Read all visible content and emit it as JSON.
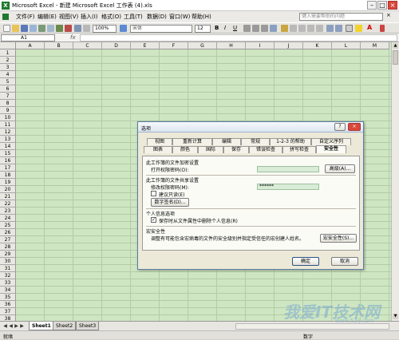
{
  "window": {
    "title": "Microsoft Excel - 新建 Microsoft Excel 工作表 (4).xls",
    "minimize": "–",
    "restore": "□",
    "close": "×"
  },
  "menu": {
    "items": [
      "文件(F)",
      "编辑(E)",
      "视图(V)",
      "插入(I)",
      "格式(O)",
      "工具(T)",
      "数据(D)",
      "窗口(W)",
      "帮助(H)"
    ],
    "help_box_placeholder": "键入需要帮助的问题"
  },
  "toolbar": {
    "zoom": "100%",
    "font": "宋体",
    "font_size": "12",
    "bold": "B",
    "italic": "I",
    "underline": "U",
    "font_color_label": "A"
  },
  "formula_bar": {
    "name_box": "A1",
    "fx": "fx"
  },
  "grid": {
    "columns": [
      "A",
      "B",
      "C",
      "D",
      "E",
      "F",
      "G",
      "H",
      "I",
      "J",
      "K",
      "L",
      "M"
    ],
    "rows": [
      "1",
      "2",
      "3",
      "4",
      "5",
      "6",
      "7",
      "8",
      "9",
      "10",
      "11",
      "12",
      "13",
      "14",
      "15",
      "16",
      "17",
      "18",
      "19",
      "20",
      "21",
      "22",
      "23",
      "24",
      "25",
      "26",
      "27",
      "28",
      "29",
      "30",
      "31",
      "32",
      "33",
      "34",
      "35",
      "36",
      "37",
      "38"
    ]
  },
  "sheets": {
    "tabs": [
      "Sheet1",
      "Sheet2",
      "Sheet3"
    ],
    "active": "Sheet1"
  },
  "status": {
    "left": "就绪",
    "right": "数字"
  },
  "dialog": {
    "title": "选项",
    "help": "?",
    "close": "×",
    "tabs_row1": [
      "视图",
      "重新计算",
      "编辑",
      "常规",
      "1-2-3 的帮助",
      "自定义序列"
    ],
    "tabs_row2": [
      "图表",
      "颜色",
      "国际",
      "保存",
      "错误检查",
      "拼写检查",
      "安全性"
    ],
    "active_tab": "安全性",
    "section_encrypt": "此工作簿的文件加密设置",
    "open_password_label": "打开权限密码(O):",
    "open_password_value": "",
    "advanced_button": "高级(A)...",
    "section_share": "此工作簿的文件共享设置",
    "modify_password_label": "修改权限密码(M):",
    "modify_password_value": "******",
    "readonly_recommended": "建议只读(E)",
    "digital_signature_button": "数字签名(D)...",
    "section_privacy": "个人信息选项",
    "remove_personal_info": "保存时从文件属性中删除个人信息(R)",
    "section_macro": "宏安全性",
    "macro_desc": "调整有可能包含宏病毒的文件的安全级别并指定受信任的宏创建人姓名。",
    "macro_button": "宏安全性(S)...",
    "ok": "确定",
    "cancel": "取消"
  },
  "watermark": {
    "text": "我爱IT技术网",
    "url": "www.52ij.com"
  }
}
